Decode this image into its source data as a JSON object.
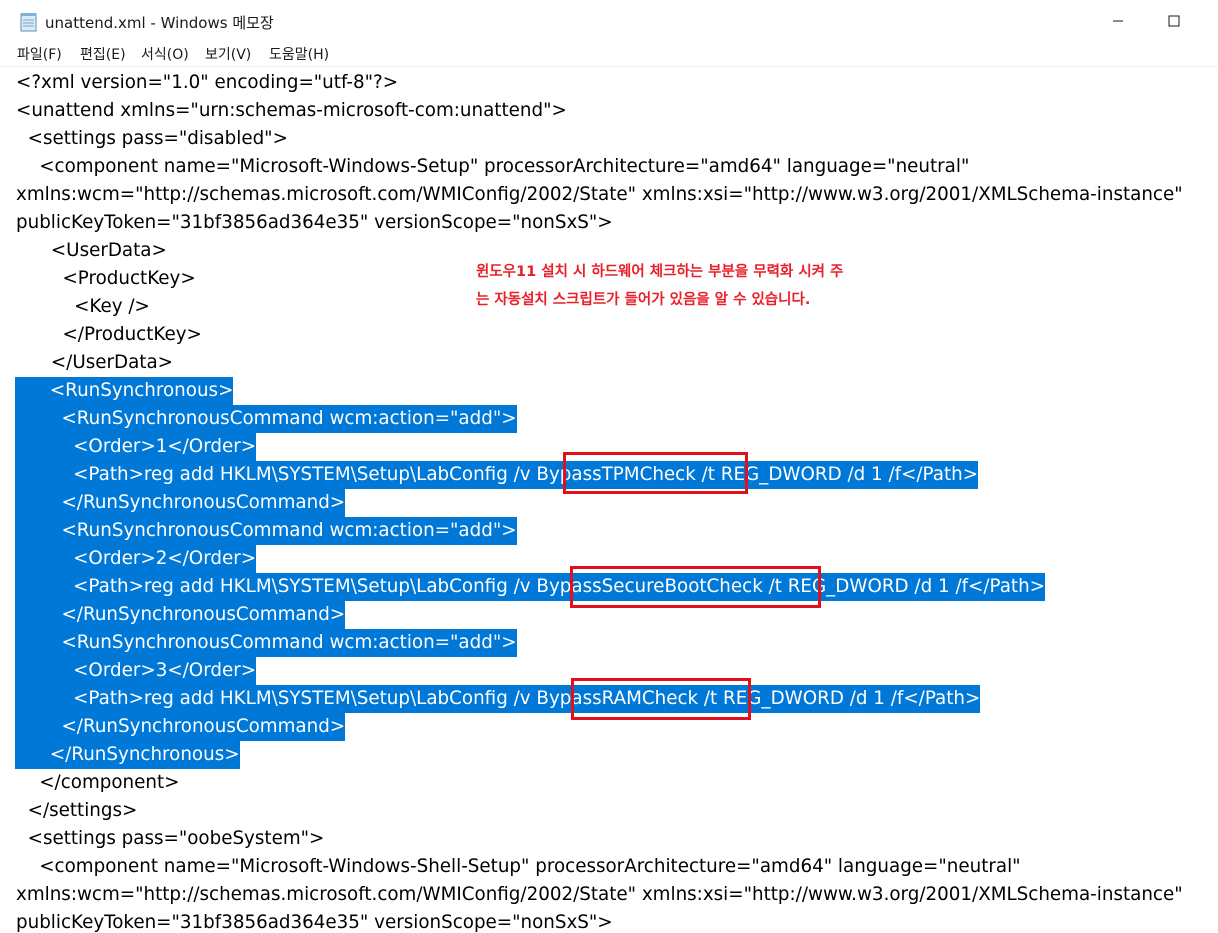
{
  "window": {
    "title": "unattend.xml - Windows 메모장",
    "minimize_icon": "minimize-icon",
    "maximize_icon": "maximize-icon"
  },
  "menu": [
    {
      "label": "파일(F)"
    },
    {
      "label": "편집(E)"
    },
    {
      "label": "서식(O)"
    },
    {
      "label": "보기(V)"
    },
    {
      "label": "도움말(H)"
    }
  ],
  "lines": [
    {
      "text": "<?xml version=\"1.0\" encoding=\"utf-8\"?>"
    },
    {
      "text": "<unattend xmlns=\"urn:schemas-microsoft-com:unattend\">"
    },
    {
      "text": "  <settings pass=\"disabled\">"
    },
    {
      "text": "    <component name=\"Microsoft-Windows-Setup\" processorArchitecture=\"amd64\" language=\"neutral\""
    },
    {
      "text": "xmlns:wcm=\"http://schemas.microsoft.com/WMIConfig/2002/State\" xmlns:xsi=\"http://www.w3.org/2001/XMLSchema-instance\""
    },
    {
      "text": "publicKeyToken=\"31bf3856ad364e35\" versionScope=\"nonSxS\">"
    },
    {
      "text": "      <UserData>"
    },
    {
      "text": "        <ProductKey>"
    },
    {
      "text": "          <Key />"
    },
    {
      "text": "        </ProductKey>"
    },
    {
      "text": "      </UserData>"
    },
    {
      "text": "      <RunSynchronous>"
    },
    {
      "text": "        <RunSynchronousCommand wcm:action=\"add\">"
    },
    {
      "text": "          <Order>1</Order>"
    },
    {
      "text": "          <Path>reg add HKLM\\SYSTEM\\Setup\\LabConfig /v BypassTPMCheck /t REG_DWORD /d 1 /f</Path>"
    },
    {
      "text": "        </RunSynchronousCommand>"
    },
    {
      "text": "        <RunSynchronousCommand wcm:action=\"add\">"
    },
    {
      "text": "          <Order>2</Order>"
    },
    {
      "text": "          <Path>reg add HKLM\\SYSTEM\\Setup\\LabConfig /v BypassSecureBootCheck /t REG_DWORD /d 1 /f</Path>"
    },
    {
      "text": "        </RunSynchronousCommand>"
    },
    {
      "text": "        <RunSynchronousCommand wcm:action=\"add\">"
    },
    {
      "text": "          <Order>3</Order>"
    },
    {
      "text": "          <Path>reg add HKLM\\SYSTEM\\Setup\\LabConfig /v BypassRAMCheck /t REG_DWORD /d 1 /f</Path>"
    },
    {
      "text": "        </RunSynchronousCommand>"
    },
    {
      "text": "      </RunSynchronous>"
    },
    {
      "text": "    </component>"
    },
    {
      "text": "  </settings>"
    },
    {
      "text": "  <settings pass=\"oobeSystem\">"
    },
    {
      "text": "    <component name=\"Microsoft-Windows-Shell-Setup\" processorArchitecture=\"amd64\" language=\"neutral\""
    },
    {
      "text": "xmlns:wcm=\"http://schemas.microsoft.com/WMIConfig/2002/State\" xmlns:xsi=\"http://www.w3.org/2001/XMLSchema-instance\""
    },
    {
      "text": "publicKeyToken=\"31bf3856ad364e35\" versionScope=\"nonSxS\">"
    }
  ],
  "annotation": {
    "line1": "윈도우11 설치 시 하드웨어 체크하는 부분을 무력화 시켜 주",
    "line2": "는 자동설치 스크립트가 들어가 있음을 알 수 있습니다."
  },
  "colors": {
    "selection": "#0078d7",
    "annotation_text": "#e8202a",
    "highlight_box": "#e2101a"
  }
}
